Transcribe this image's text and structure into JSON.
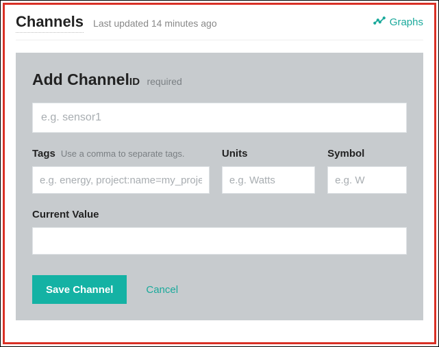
{
  "header": {
    "title": "Channels",
    "last_updated": "Last updated 14 minutes ago",
    "graphs_label": "Graphs"
  },
  "form": {
    "heading_main": "Add Channel",
    "heading_id": "ID",
    "heading_req": "required",
    "channel_id_placeholder": "e.g. sensor1",
    "tags": {
      "label": "Tags",
      "hint": "Use a comma to separate tags.",
      "placeholder": "e.g. energy, project:name=my_project"
    },
    "units": {
      "label": "Units",
      "placeholder": "e.g. Watts"
    },
    "symbol": {
      "label": "Symbol",
      "placeholder": "e.g. W"
    },
    "current_value": {
      "label": "Current Value",
      "value": ""
    },
    "actions": {
      "save": "Save Channel",
      "cancel": "Cancel"
    }
  },
  "colors": {
    "accent": "#14b2a4",
    "link": "#1aa99b",
    "card_bg": "#c7cbce",
    "highlight_border": "#d93025"
  }
}
